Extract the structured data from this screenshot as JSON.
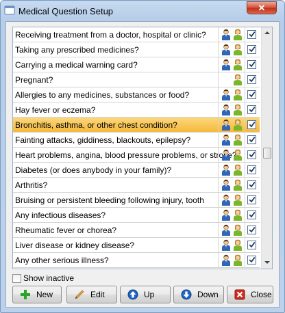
{
  "window": {
    "title": "Medical Question Setup",
    "close_glyph": "✕"
  },
  "questions": [
    {
      "text": "Receiving treatment from a doctor, hospital or clinic?",
      "male": true,
      "female": true,
      "active": true
    },
    {
      "text": "Taking any prescribed medicines?",
      "male": true,
      "female": true,
      "active": true
    },
    {
      "text": "Carrying a medical warning card?",
      "male": true,
      "female": true,
      "active": true
    },
    {
      "text": "Pregnant?",
      "male": false,
      "female": true,
      "active": true
    },
    {
      "text": "Allergies to any medicines, substances or food?",
      "male": true,
      "female": true,
      "active": true
    },
    {
      "text": "Hay fever or eczema?",
      "male": true,
      "female": true,
      "active": true
    },
    {
      "text": "Bronchitis, asthma, or other chest condition?",
      "male": true,
      "female": true,
      "active": true,
      "selected": true
    },
    {
      "text": "Fainting attacks, giddiness, blackouts, epilepsy?",
      "male": true,
      "female": true,
      "active": true
    },
    {
      "text": "Heart problems, angina, blood pressure problems, or stroke?",
      "male": true,
      "female": true,
      "active": true
    },
    {
      "text": "Diabetes (or does anybody in your family)?",
      "male": true,
      "female": true,
      "active": true
    },
    {
      "text": "Arthritis?",
      "male": true,
      "female": true,
      "active": true
    },
    {
      "text": "Bruising or persistent bleeding following injury, tooth",
      "male": true,
      "female": true,
      "active": true
    },
    {
      "text": "Any infectious diseases?",
      "male": true,
      "female": true,
      "active": true
    },
    {
      "text": "Rheumatic fever or chorea?",
      "male": true,
      "female": true,
      "active": true
    },
    {
      "text": "Liver disease or kidney disease?",
      "male": true,
      "female": true,
      "active": true
    },
    {
      "text": "Any other serious illness?",
      "male": true,
      "female": true,
      "active": true
    }
  ],
  "show_inactive": {
    "label": "Show inactive",
    "checked": false
  },
  "buttons": {
    "new": {
      "label": "New",
      "icon": "plus-icon"
    },
    "edit": {
      "label": "Edit",
      "icon": "pencil-icon"
    },
    "up": {
      "label": "Up",
      "icon": "arrow-up-icon"
    },
    "down": {
      "label": "Down",
      "icon": "arrow-down-icon"
    },
    "close": {
      "label": "Close",
      "icon": "close-x-icon"
    }
  },
  "colors": {
    "selected_row": "#f6b93a",
    "male_icon": "#2f66b5",
    "female_icon": "#7ab629",
    "new_icon": "#2aa52a",
    "nav_icon": "#1f63c4",
    "close_icon": "#d12c1e"
  }
}
